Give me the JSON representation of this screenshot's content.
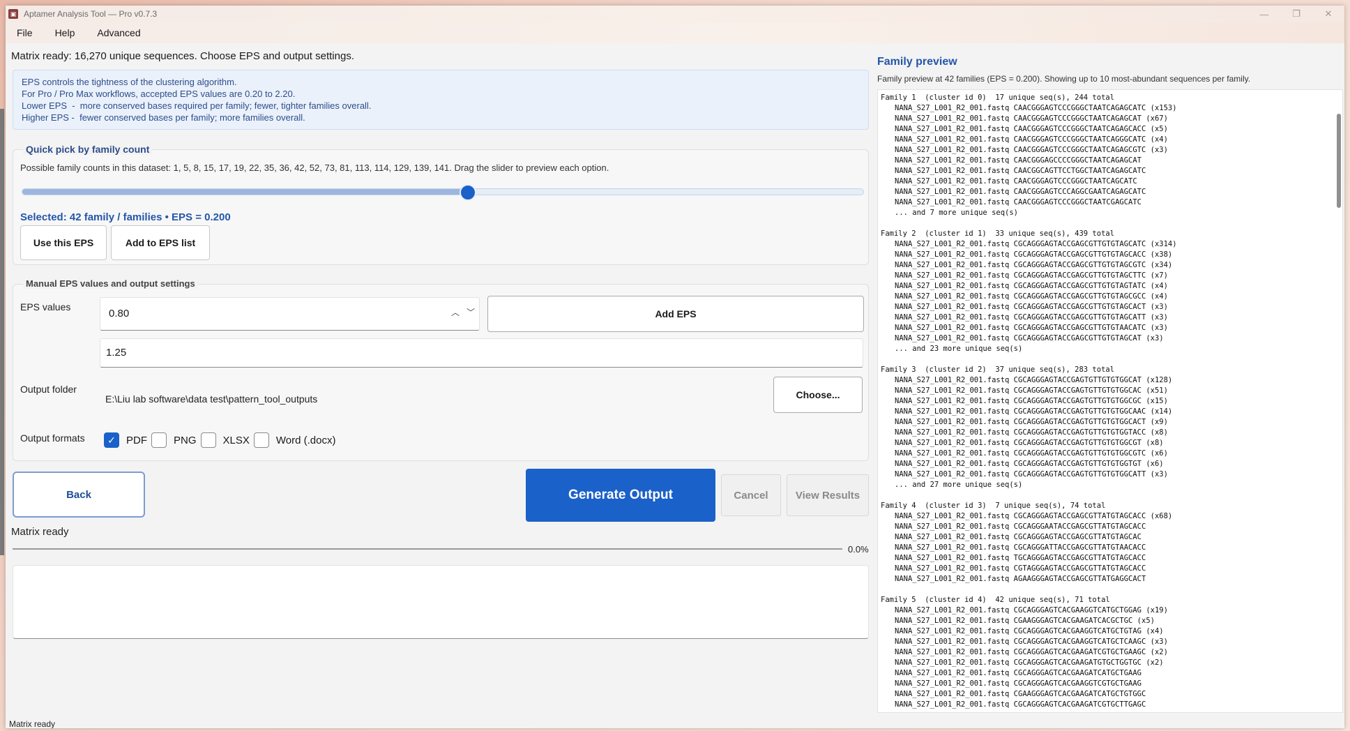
{
  "window": {
    "title": "Aptamer Analysis Tool — Pro v0.7.3",
    "controls": [
      "—",
      "❐",
      "✕"
    ]
  },
  "menu": [
    "File",
    "Help",
    "Advanced"
  ],
  "status_top": "Matrix ready: 16,270 unique sequences. Choose EPS and output settings.",
  "info": [
    "EPS controls the tightness of the clustering algorithm.",
    "For Pro / Pro Max workflows, accepted EPS values are 0.20 to 2.20.",
    "Lower EPS  -  more conserved bases required per family; fewer, tighter families overall.",
    "Higher EPS -  fewer conserved bases per family; more families overall."
  ],
  "quick_pick": {
    "title": "Quick pick by family count",
    "description": "Possible family counts in this dataset: 1, 5, 8, 15, 17, 19, 22, 35, 36, 42, 52, 73, 81, 113, 114, 129, 139, 141. Drag the slider to preview each option.",
    "slider_fraction": 0.53,
    "selected": "Selected: 42 family / families  •  EPS = 0.200",
    "use_btn": "Use this EPS",
    "add_btn": "Add to EPS list"
  },
  "manual": {
    "title": "Manual EPS values and output settings",
    "eps_label": "EPS values",
    "eps_value": "0.80",
    "add_eps_btn": "Add EPS",
    "eps_list_item": "1.25",
    "output_folder_label": "Output folder",
    "output_folder_path": "E:\\Liu lab software\\data test\\pattern_tool_outputs",
    "choose_btn": "Choose...",
    "output_formats_label": "Output formats",
    "formats": [
      {
        "label": "PDF",
        "checked": true
      },
      {
        "label": "PNG",
        "checked": false
      },
      {
        "label": "XLSX",
        "checked": false
      },
      {
        "label": "Word (.docx)",
        "checked": false
      }
    ]
  },
  "actions": {
    "back": "Back",
    "generate": "Generate Output",
    "cancel": "Cancel",
    "view_results": "View Results"
  },
  "status_mid": "Matrix ready",
  "progress": {
    "value": 0.0,
    "label": "0.0%"
  },
  "statusbar": "Matrix ready",
  "family_preview": {
    "title": "Family preview",
    "subtitle": "Family preview at 42 families (EPS = 0.200). Showing up to 10 most-abundant sequences per family.",
    "families": [
      {
        "header": "Family 1  (cluster id 0)  17 unique seq(s), 244 total",
        "lines": [
          "NANA_S27_L001_R2_001.fastq CAACGGGAGTCCCGGGCTAATCAGAGCATC (x153)",
          "NANA_S27_L001_R2_001.fastq CAACGGGAGTCCCGGGCTAATCAGAGCAT (x67)",
          "NANA_S27_L001_R2_001.fastq CAACGGGAGTCCCGGGCTAATCAGAGCACC (x5)",
          "NANA_S27_L001_R2_001.fastq CAACGGGAGTCCCGGGCTAATCAGGGCATC (x4)",
          "NANA_S27_L001_R2_001.fastq CAACGGGAGTCCCGGGCTAATCAGAGCGTC (x3)",
          "NANA_S27_L001_R2_001.fastq CAACGGGAGCCCCGGGCTAATCAGAGCAT",
          "NANA_S27_L001_R2_001.fastq CAACGGCAGTTCCTGGCTAATCAGAGCATC",
          "NANA_S27_L001_R2_001.fastq CAACGGGAGTCCCGGGCTAATCAGCATC",
          "NANA_S27_L001_R2_001.fastq CAACGGGAGTCCCAGGCGAATCAGAGCATC",
          "NANA_S27_L001_R2_001.fastq CAACGGGAGTCCCGGGCTAATCGAGCATC",
          "... and 7 more unique seq(s)"
        ]
      },
      {
        "header": "Family 2  (cluster id 1)  33 unique seq(s), 439 total",
        "lines": [
          "NANA_S27_L001_R2_001.fastq CGCAGGGAGTACCGAGCGTTGTGTAGCATC (x314)",
          "NANA_S27_L001_R2_001.fastq CGCAGGGAGTACCGAGCGTTGTGTAGCACC (x38)",
          "NANA_S27_L001_R2_001.fastq CGCAGGGAGTACCGAGCGTTGTGTAGCGTC (x34)",
          "NANA_S27_L001_R2_001.fastq CGCAGGGAGTACCGAGCGTTGTGTAGCTTC (x7)",
          "NANA_S27_L001_R2_001.fastq CGCAGGGAGTACCGAGCGTTGTGTAGTATC (x4)",
          "NANA_S27_L001_R2_001.fastq CGCAGGGAGTACCGAGCGTTGTGTAGCGCC (x4)",
          "NANA_S27_L001_R2_001.fastq CGCAGGGAGTACCGAGCGTTGTGTAGCACT (x3)",
          "NANA_S27_L001_R2_001.fastq CGCAGGGAGTACCGAGCGTTGTGTAGCATT (x3)",
          "NANA_S27_L001_R2_001.fastq CGCAGGGAGTACCGAGCGTTGTGTAACATC (x3)",
          "NANA_S27_L001_R2_001.fastq CGCAGGGAGTACCGAGCGTTGTGTAGCAT (x3)",
          "... and 23 more unique seq(s)"
        ]
      },
      {
        "header": "Family 3  (cluster id 2)  37 unique seq(s), 283 total",
        "lines": [
          "NANA_S27_L001_R2_001.fastq CGCAGGGAGTACCGAGTGTTGTGTGGCAT (x128)",
          "NANA_S27_L001_R2_001.fastq CGCAGGGAGTACCGAGTGTTGTGTGGCAC (x51)",
          "NANA_S27_L001_R2_001.fastq CGCAGGGAGTACCGAGTGTTGTGTGGCGC (x15)",
          "NANA_S27_L001_R2_001.fastq CGCAGGGAGTACCGAGTGTTGTGTGGCAAC (x14)",
          "NANA_S27_L001_R2_001.fastq CGCAGGGAGTACCGAGTGTTGTGTGGCACT (x9)",
          "NANA_S27_L001_R2_001.fastq CGCAGGGAGTACCGAGTGTTGTGTGGTACC (x8)",
          "NANA_S27_L001_R2_001.fastq CGCAGGGAGTACCGAGTGTTGTGTGGCGT (x8)",
          "NANA_S27_L001_R2_001.fastq CGCAGGGAGTACCGAGTGTTGTGTGGCGTC (x6)",
          "NANA_S27_L001_R2_001.fastq CGCAGGGAGTACCGAGTGTTGTGTGGTGT (x6)",
          "NANA_S27_L001_R2_001.fastq CGCAGGGAGTACCGAGTGTTGTGTGGCATT (x3)",
          "... and 27 more unique seq(s)"
        ]
      },
      {
        "header": "Family 4  (cluster id 3)  7 unique seq(s), 74 total",
        "lines": [
          "NANA_S27_L001_R2_001.fastq CGCAGGGAGTACCGAGCGTTATGTAGCACC (x68)",
          "NANA_S27_L001_R2_001.fastq CGCAGGGAATACCGAGCGTTATGTAGCACC",
          "NANA_S27_L001_R2_001.fastq CGCAGGGAGTACCGAGCGTTATGTAGCAC",
          "NANA_S27_L001_R2_001.fastq CGCAGGGATTACCGAGCGTTATGTAACACC",
          "NANA_S27_L001_R2_001.fastq TGCAGGGAGTACCGAGCGTTATGTAGCACC",
          "NANA_S27_L001_R2_001.fastq CGTAGGGAGTACCGAGCGTTATGTAGCACC",
          "NANA_S27_L001_R2_001.fastq AGAAGGGAGTACCGAGCGTTATGAGGCACT"
        ]
      },
      {
        "header": "Family 5  (cluster id 4)  42 unique seq(s), 71 total",
        "lines": [
          "NANA_S27_L001_R2_001.fastq CGCAGGGAGTCACGAAGGTCATGCTGGAG (x19)",
          "NANA_S27_L001_R2_001.fastq CGAAGGGAGTCACGAAGATCACGCTGC (x5)",
          "NANA_S27_L001_R2_001.fastq CGCAGGGAGTCACGAAGGTCATGCTGTAG (x4)",
          "NANA_S27_L001_R2_001.fastq CGCAGGGAGTCACGAAGGTCATGCTCAAGC (x3)",
          "NANA_S27_L001_R2_001.fastq CGCAGGGAGTCACGAAGATCGTGCTGAAGC (x2)",
          "NANA_S27_L001_R2_001.fastq CGCAGGGAGTCACGAAGATGTGCTGGTGC (x2)",
          "NANA_S27_L001_R2_001.fastq CGCAGGGAGTCACGAAGATCATGCTGAAG",
          "NANA_S27_L001_R2_001.fastq CGCAGGGAGTCACGAAGGTCGTGCTGAAG",
          "NANA_S27_L001_R2_001.fastq CGAAGGGAGTCACGAAGATCATGCTGTGGC",
          "NANA_S27_L001_R2_001.fastq CGCAGGGAGTCACGAAGATCGTGCTTGAGC"
        ]
      }
    ]
  }
}
